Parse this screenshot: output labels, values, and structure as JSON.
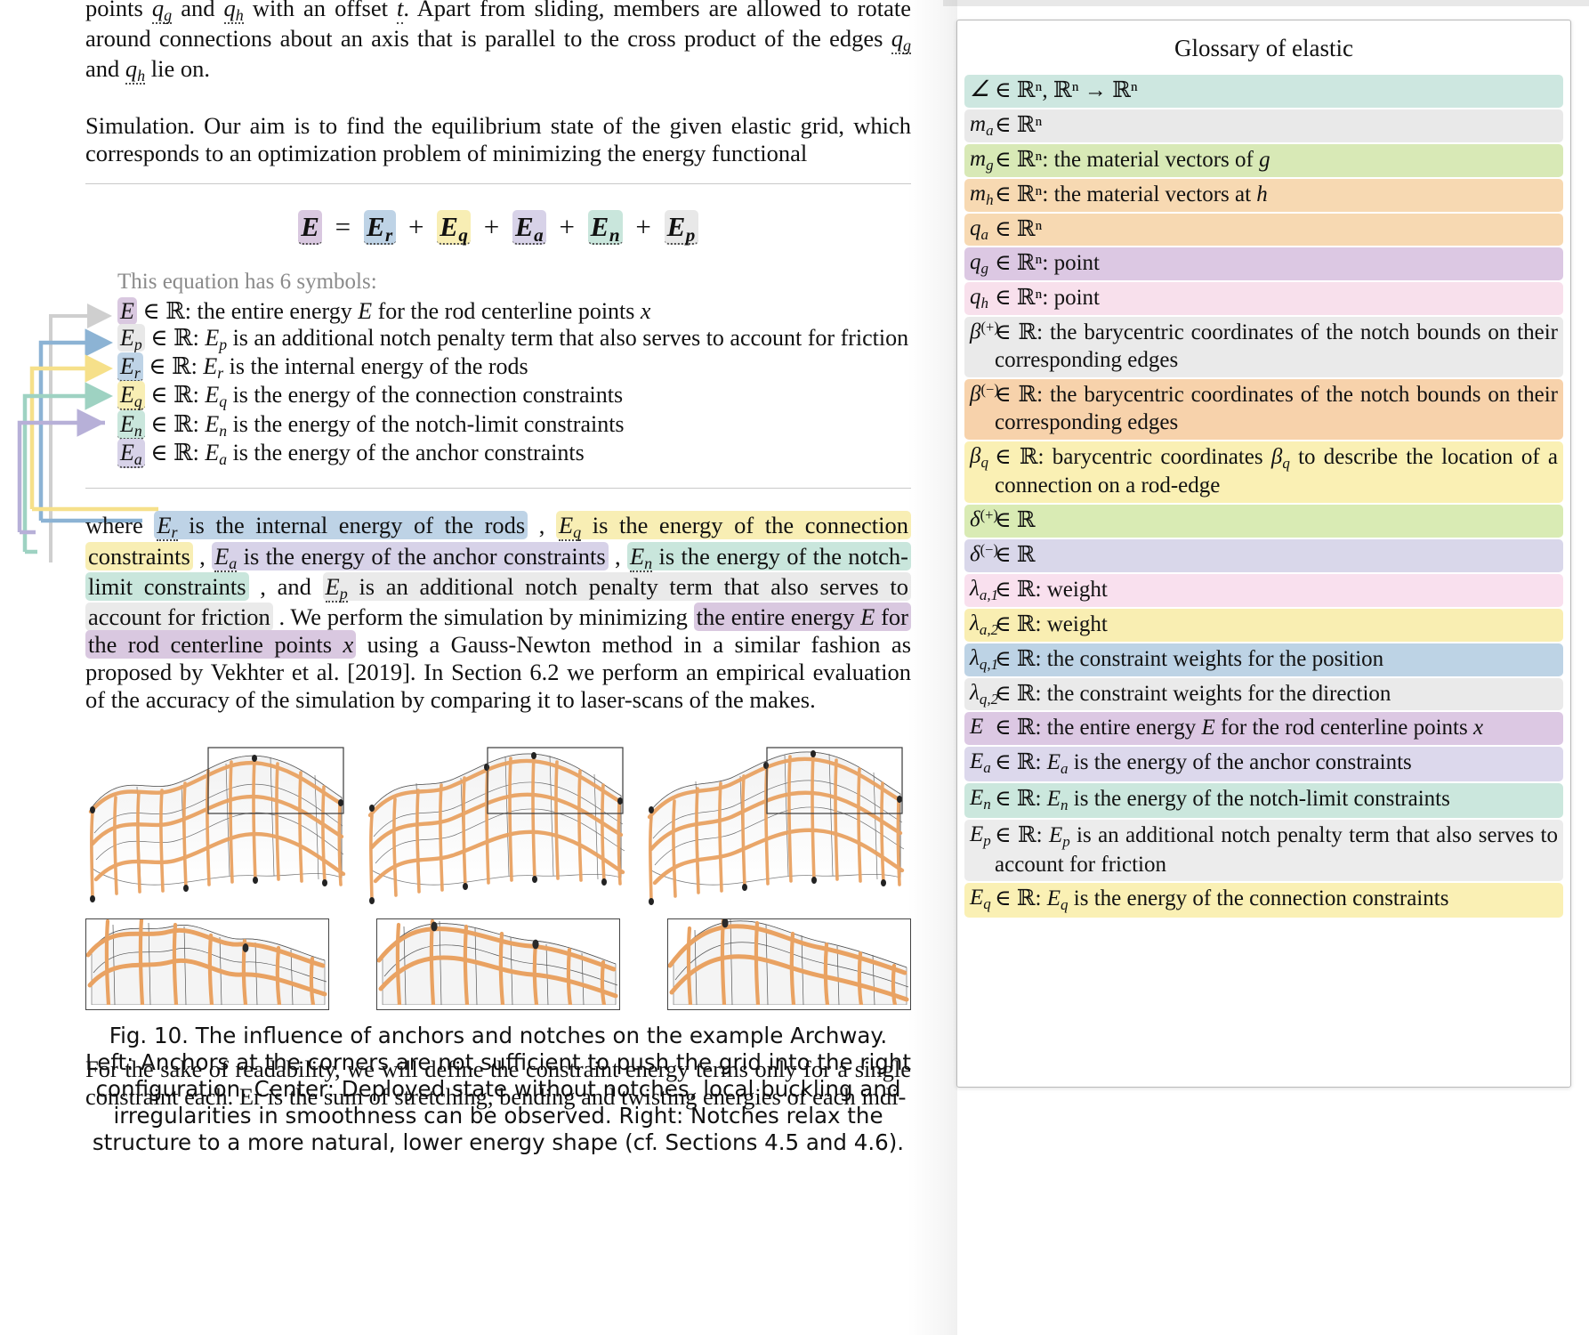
{
  "document": {
    "para_top": "points q_g and q_h with an offset t. Apart from sliding, members are allowed to rotate around connections about an axis that is parallel to the cross product of the edges q_g and q_h lie on.",
    "para_sim": "Simulation. Our aim is to find the equilibrium state of the given elastic grid, which corresponds to an optimization problem of minimizing the energy functional",
    "equation": "E = E_r + E_q + E_a + E_n + E_p",
    "symbols_intro": "This equation has 6 symbols:",
    "symbols": [
      {
        "sym": "E",
        "text": "∈ ℝ: the entire energy E for the rod centerline points x",
        "color": "#d9c8e0",
        "arrow": false
      },
      {
        "sym": "E_p",
        "text": "∈ ℝ: E_p is an additional notch penalty term that also serves to account for friction",
        "color": "#e8e8e8",
        "arrow": true
      },
      {
        "sym": "E_r",
        "text": "∈ ℝ: E_r is the internal energy of the rods",
        "color": "#bed3e6",
        "arrow": true
      },
      {
        "sym": "E_q",
        "text": "∈ ℝ: E_q is the energy of the connection constraints",
        "color": "#f8eeb4",
        "arrow": true
      },
      {
        "sym": "E_n",
        "text": "∈ ℝ: E_n is the energy of the notch-limit constraints",
        "color": "#c9e6dc",
        "arrow": true
      },
      {
        "sym": "E_a",
        "text": "∈ ℝ: E_a is the energy of the anchor constraints",
        "color": "#d7d2e8",
        "arrow": true
      }
    ],
    "para_where_parts": [
      {
        "t": "where ",
        "hl": null
      },
      {
        "t": "E_r is the internal energy of the rods",
        "hl": "#bed3e6"
      },
      {
        "t": " , ",
        "hl": null
      },
      {
        "t": "E_q is the energy of the connection constraints",
        "hl": "#f8eeb4"
      },
      {
        "t": " , ",
        "hl": null
      },
      {
        "t": "E_a is the energy of the anchor constraints",
        "hl": "#d7d2e8"
      },
      {
        "t": " , ",
        "hl": null
      },
      {
        "t": "E_n is the energy of the notch-limit constraints",
        "hl": "#c9e6dc"
      },
      {
        "t": " , and ",
        "hl": null
      },
      {
        "t": "E_p is an additional notch penalty term that also serves to account for friction",
        "hl": "#eaeaea"
      },
      {
        "t": " . We perform the simulation by minimizing ",
        "hl": null
      },
      {
        "t": "the entire energy E for the rod centerline points x",
        "hl": "#d9c8e0"
      },
      {
        "t": " using a Gauss-Newton method in a similar fashion as proposed by Vekhter et al. [2019]. In Section 6.2 we perform an empirical evaluation of the accuracy of the simulation by comparing it to laser-scans of the makes.",
        "hl": null
      }
    ],
    "caption": "Fig. 10. The influence of anchors and notches on the example Archway. Left: Anchors at the corners are not sufficient to push the grid into the right configuration. Center: Deployed state without notches, local buckling and irregularities in smoothness can be observed. Right: Notches relax the structure to a more natural, lower energy shape (cf. Sections 4.5 and 4.6).",
    "para_bottom": "For the sake of readability, we will define the constraint energy terms only for a single constraint each. Er is the sum of stretching, bending and twisting energies of each indi-"
  },
  "glossary": {
    "title": "Glossary of elastic",
    "entries": [
      {
        "lead": "∠",
        "sub": "",
        "sup": "",
        "rest": "∈ ℝⁿ, ℝⁿ → ℝⁿ",
        "color": "#cde7e0",
        "nowrap": true
      },
      {
        "lead": "m",
        "sub": "a",
        "sup": "",
        "rest": "∈ ℝⁿ",
        "color": "#e9e9e9",
        "nowrap": true
      },
      {
        "lead": "m",
        "sub": "g",
        "sup": "",
        "rest": "∈ ℝⁿ: the material vectors of g",
        "color": "#d8e9b6",
        "nowrap": true
      },
      {
        "lead": "m",
        "sub": "h",
        "sup": "",
        "rest": "∈ ℝⁿ: the material vectors at h",
        "color": "#f7d9b2",
        "nowrap": true
      },
      {
        "lead": "q",
        "sub": "a",
        "sup": "",
        "rest": "∈ ℝⁿ",
        "color": "#f7d9b2",
        "nowrap": true
      },
      {
        "lead": "q",
        "sub": "g",
        "sup": "",
        "rest": "∈ ℝⁿ: point",
        "color": "#dcc8e3",
        "nowrap": true
      },
      {
        "lead": "q",
        "sub": "h",
        "sup": "",
        "rest": "∈ ℝⁿ: point",
        "color": "#f8e0ec",
        "nowrap": true
      },
      {
        "lead": "β",
        "sub": "",
        "sup": "(+)",
        "rest": "∈ ℝ: the barycentric coordinates of the notch bounds on their corresponding edges",
        "color": "#eaeaea",
        "nowrap": false
      },
      {
        "lead": "β",
        "sub": "",
        "sup": "(−)",
        "rest": "∈ ℝ: the barycentric coordinates of the notch bounds on their corresponding edges",
        "color": "#f7d2ab",
        "nowrap": false
      },
      {
        "lead": "β",
        "sub": "q",
        "sup": "",
        "rest": "∈ ℝ: barycentric coordinates β_q to describe the location of a connection on a rod-edge",
        "color": "#faf0b4",
        "nowrap": false
      },
      {
        "lead": "δ",
        "sub": "",
        "sup": "(+)",
        "rest": "∈ ℝ",
        "color": "#d9ebb4",
        "nowrap": true
      },
      {
        "lead": "δ",
        "sub": "",
        "sup": "(−)",
        "rest": "∈ ℝ",
        "color": "#d9d7ea",
        "nowrap": true
      },
      {
        "lead": "λ",
        "sub": "a,1",
        "sup": "",
        "rest": "∈ ℝ: weight",
        "color": "#f9e0ee",
        "nowrap": true
      },
      {
        "lead": "λ",
        "sub": "a,2",
        "sup": "",
        "rest": "∈ ℝ: weight",
        "color": "#f9eeb2",
        "nowrap": true
      },
      {
        "lead": "λ",
        "sub": "q,1",
        "sup": "",
        "rest": "∈ ℝ: the constraint weights for the position",
        "color": "#bdd3e5",
        "nowrap": false
      },
      {
        "lead": "λ",
        "sub": "q,2",
        "sup": "",
        "rest": "∈ ℝ: the constraint weights for the direction",
        "color": "#eaeaea",
        "nowrap": false
      },
      {
        "lead": "E",
        "sub": "",
        "sup": "",
        "rest": "∈ ℝ: the entire energy E for the rod centerline points x",
        "color": "#dcc8e3",
        "nowrap": false
      },
      {
        "lead": "E",
        "sub": "a",
        "sup": "",
        "rest": "∈ ℝ: E_a is the energy of the anchor constraints",
        "color": "#dcd8ec",
        "nowrap": false
      },
      {
        "lead": "E",
        "sub": "n",
        "sup": "",
        "rest": "∈ ℝ: E_n is the energy of the notch-limit constraints",
        "color": "#cbe7dd",
        "nowrap": false
      },
      {
        "lead": "E",
        "sub": "p",
        "sup": "",
        "rest": "∈ ℝ: E_p is an additional notch penalty term that also serves to account for friction",
        "color": "#ececec",
        "nowrap": false
      },
      {
        "lead": "E",
        "sub": "q",
        "sup": "",
        "rest": "∈ ℝ: E_q is the energy of the connection constraints",
        "color": "#faf0b4",
        "nowrap": false
      }
    ]
  },
  "colors": {
    "arrow_gray": "#cfcfcf",
    "arrow_blue": "#8cb3d4",
    "arrow_yellow": "#f6e08a",
    "arrow_teal": "#9ed2c2",
    "arrow_purple": "#b7b0d8",
    "rod_orange": "#e9a262",
    "panel_border": "#b9b9b9"
  }
}
